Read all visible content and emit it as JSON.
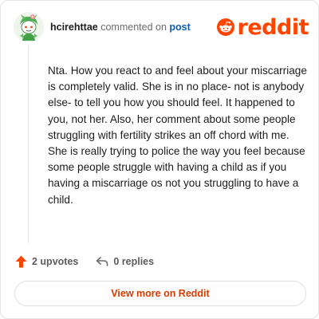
{
  "header": {
    "username": "hcirehttae",
    "action_text": "commented on",
    "post_link": "post",
    "logo_text": "reddit"
  },
  "comment": {
    "body": "Nta. How you react to and feel about your miscarriage is completely valid. She is in no place- not is anybody else- to tell you how you should feel. It happened to you, not her. Also, her comment about some people struggling with fertility strikes an off chord with me. She is really trying to police the way you feel because some people struggle with having a child as if you having a miscarriage os not you struggling to have a child."
  },
  "actions": {
    "upvotes": "2 upvotes",
    "replies": "0 replies"
  },
  "footer": {
    "view_more": "View more on Reddit"
  },
  "colors": {
    "brand": "#ff4500",
    "upvote": "#ff4500",
    "link": "#0b5db3",
    "view_more_text": "#d93a00"
  }
}
